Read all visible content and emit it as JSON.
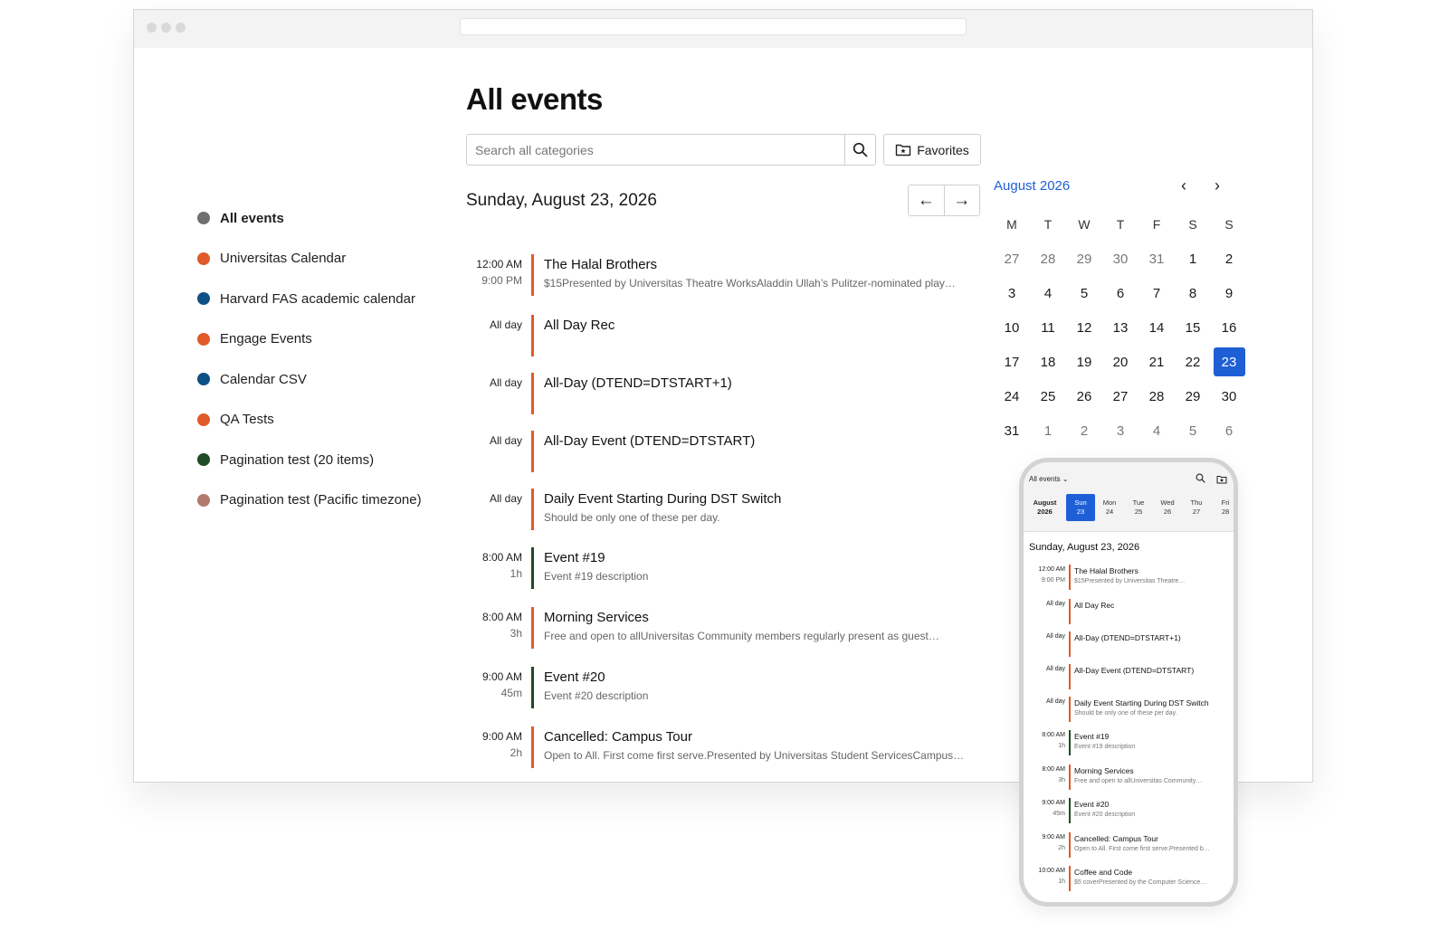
{
  "page": {
    "title": "All events",
    "day_heading": "Sunday, August 23, 2026"
  },
  "search": {
    "placeholder": "Search all categories"
  },
  "favorites_label": "Favorites",
  "nav": {
    "prev": "←",
    "next": "→"
  },
  "categories": [
    {
      "label": "All events",
      "color": "#707070",
      "active": true
    },
    {
      "label": "Universitas Calendar",
      "color": "#e05a2a"
    },
    {
      "label": "Harvard FAS academic calendar",
      "color": "#0e4f86"
    },
    {
      "label": "Engage Events",
      "color": "#e05a2a"
    },
    {
      "label": "Calendar CSV",
      "color": "#0e4f86"
    },
    {
      "label": "QA Tests",
      "color": "#e05a2a"
    },
    {
      "label": "Pagination test (20 items)",
      "color": "#1f4a24"
    },
    {
      "label": "Pagination test (Pacific timezone)",
      "color": "#b27a6d"
    }
  ],
  "events": [
    {
      "time": "12:00 AM",
      "sub": "9:00 PM",
      "title": "The Halal Brothers",
      "desc": "$15Presented by Universitas Theatre WorksAladdin Ullah’s Pulitzer-nominated play…",
      "color": "#e05a2a"
    },
    {
      "time": "All day",
      "sub": "",
      "title": "All Day Rec",
      "desc": "",
      "color": "#e05a2a"
    },
    {
      "time": "All day",
      "sub": "",
      "title": "All-Day (DTEND=DTSTART+1)",
      "desc": "",
      "color": "#e05a2a"
    },
    {
      "time": "All day",
      "sub": "",
      "title": "All-Day Event (DTEND=DTSTART)",
      "desc": "",
      "color": "#e05a2a"
    },
    {
      "time": "All day",
      "sub": "",
      "title": "Daily Event Starting During DST Switch",
      "desc": "Should be only one of these per day.",
      "color": "#e05a2a"
    },
    {
      "time": "8:00 AM",
      "sub": "1h",
      "title": "Event #19",
      "desc": "Event #19 description",
      "color": "#1f4a24"
    },
    {
      "time": "8:00 AM",
      "sub": "3h",
      "title": "Morning Services",
      "desc": "Free and open to allUniversitas Community members regularly present as guest…",
      "color": "#e05a2a"
    },
    {
      "time": "9:00 AM",
      "sub": "45m",
      "title": "Event #20",
      "desc": "Event #20 description",
      "color": "#1f4a24"
    },
    {
      "time": "9:00 AM",
      "sub": "2h",
      "title": "Cancelled: Campus Tour",
      "desc": "Open to All. First come first serve.Presented by Universitas Student ServicesCampus…",
      "color": "#e05a2a"
    }
  ],
  "calendar": {
    "title": "August 2026",
    "prev_icon": "‹",
    "next_icon": "›",
    "weekdays": [
      "M",
      "T",
      "W",
      "T",
      "F",
      "S",
      "S"
    ],
    "weeks": [
      [
        "27",
        "28",
        "29",
        "30",
        "31",
        "1",
        "2"
      ],
      [
        "3",
        "4",
        "5",
        "6",
        "7",
        "8",
        "9"
      ],
      [
        "10",
        "11",
        "12",
        "13",
        "14",
        "15",
        "16"
      ],
      [
        "17",
        "18",
        "19",
        "20",
        "21",
        "22",
        "23"
      ],
      [
        "24",
        "25",
        "26",
        "27",
        "28",
        "29",
        "30"
      ],
      [
        "31",
        "1",
        "2",
        "3",
        "4",
        "5",
        "6"
      ]
    ],
    "selected": "23",
    "accent": "#1f5fd6"
  },
  "phone": {
    "selector": "All events ⌄",
    "month_label": [
      "August",
      "2026"
    ],
    "days": [
      {
        "name": "Sun",
        "num": "23",
        "selected": true
      },
      {
        "name": "Mon",
        "num": "24"
      },
      {
        "name": "Tue",
        "num": "25"
      },
      {
        "name": "Wed",
        "num": "26"
      },
      {
        "name": "Thu",
        "num": "27"
      },
      {
        "name": "Fri",
        "num": "28"
      }
    ],
    "date_heading": "Sunday, August 23, 2026",
    "events": [
      {
        "time": "12:00 AM",
        "sub": "9:00 PM",
        "title": "The Halal Brothers",
        "desc": "$15Presented by Universitas Theatre…",
        "color": "#e05a2a"
      },
      {
        "time": "All day",
        "sub": "",
        "title": "All Day Rec",
        "desc": "",
        "color": "#e05a2a"
      },
      {
        "time": "All day",
        "sub": "",
        "title": "All-Day (DTEND=DTSTART+1)",
        "desc": "",
        "color": "#e05a2a"
      },
      {
        "time": "All day",
        "sub": "",
        "title": "All-Day Event (DTEND=DTSTART)",
        "desc": "",
        "color": "#e05a2a"
      },
      {
        "time": "All day",
        "sub": "",
        "title": "Daily Event Starting During DST Switch",
        "desc": "Should be only one of these per day.",
        "color": "#e05a2a"
      },
      {
        "time": "8:00 AM",
        "sub": "1h",
        "title": "Event #19",
        "desc": "Event #19 description",
        "color": "#1f4a24"
      },
      {
        "time": "8:00 AM",
        "sub": "3h",
        "title": "Morning Services",
        "desc": "Free and open to allUniversitas Community…",
        "color": "#e05a2a"
      },
      {
        "time": "9:00 AM",
        "sub": "45m",
        "title": "Event #20",
        "desc": "Event #20 description",
        "color": "#1f4a24"
      },
      {
        "time": "9:00 AM",
        "sub": "2h",
        "title": "Cancelled: Campus Tour",
        "desc": "Open to All. First come first serve.Presented b…",
        "color": "#e05a2a"
      },
      {
        "time": "10:00 AM",
        "sub": "1h",
        "title": "Coffee and Code",
        "desc": "$5 coverPresented by the Computer Science…",
        "color": "#e05a2a"
      }
    ]
  }
}
